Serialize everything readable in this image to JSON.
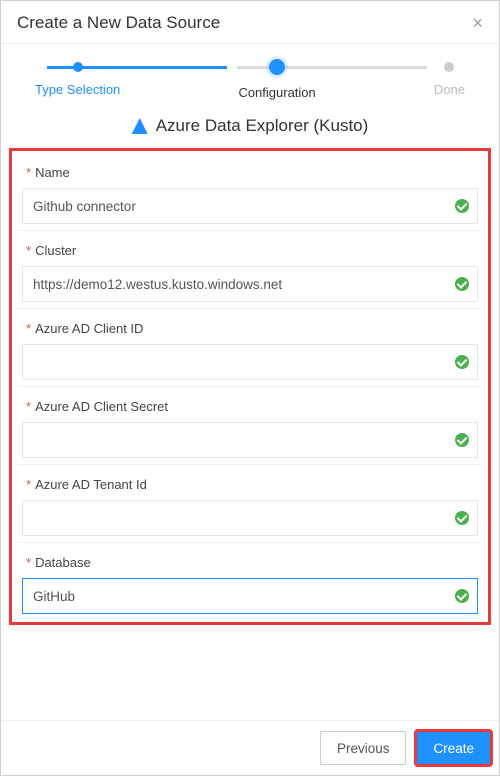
{
  "dialog": {
    "title": "Create a New Data Source",
    "close_label": "×"
  },
  "stepper": {
    "steps": [
      {
        "label": "Type Selection"
      },
      {
        "label": "Configuration"
      },
      {
        "label": "Done"
      }
    ]
  },
  "source": {
    "name": "Azure Data Explorer (Kusto)"
  },
  "form": {
    "fields": {
      "name": {
        "label": "Name",
        "value": "Github connector"
      },
      "cluster": {
        "label": "Cluster",
        "value": "https://demo12.westus.kusto.windows.net"
      },
      "clientId": {
        "label": "Azure AD Client ID",
        "value": ""
      },
      "secret": {
        "label": "Azure AD Client Secret",
        "value": ""
      },
      "tenant": {
        "label": "Azure AD Tenant Id",
        "value": ""
      },
      "database": {
        "label": "Database",
        "value": "GitHub"
      }
    }
  },
  "footer": {
    "previous": "Previous",
    "create": "Create"
  }
}
